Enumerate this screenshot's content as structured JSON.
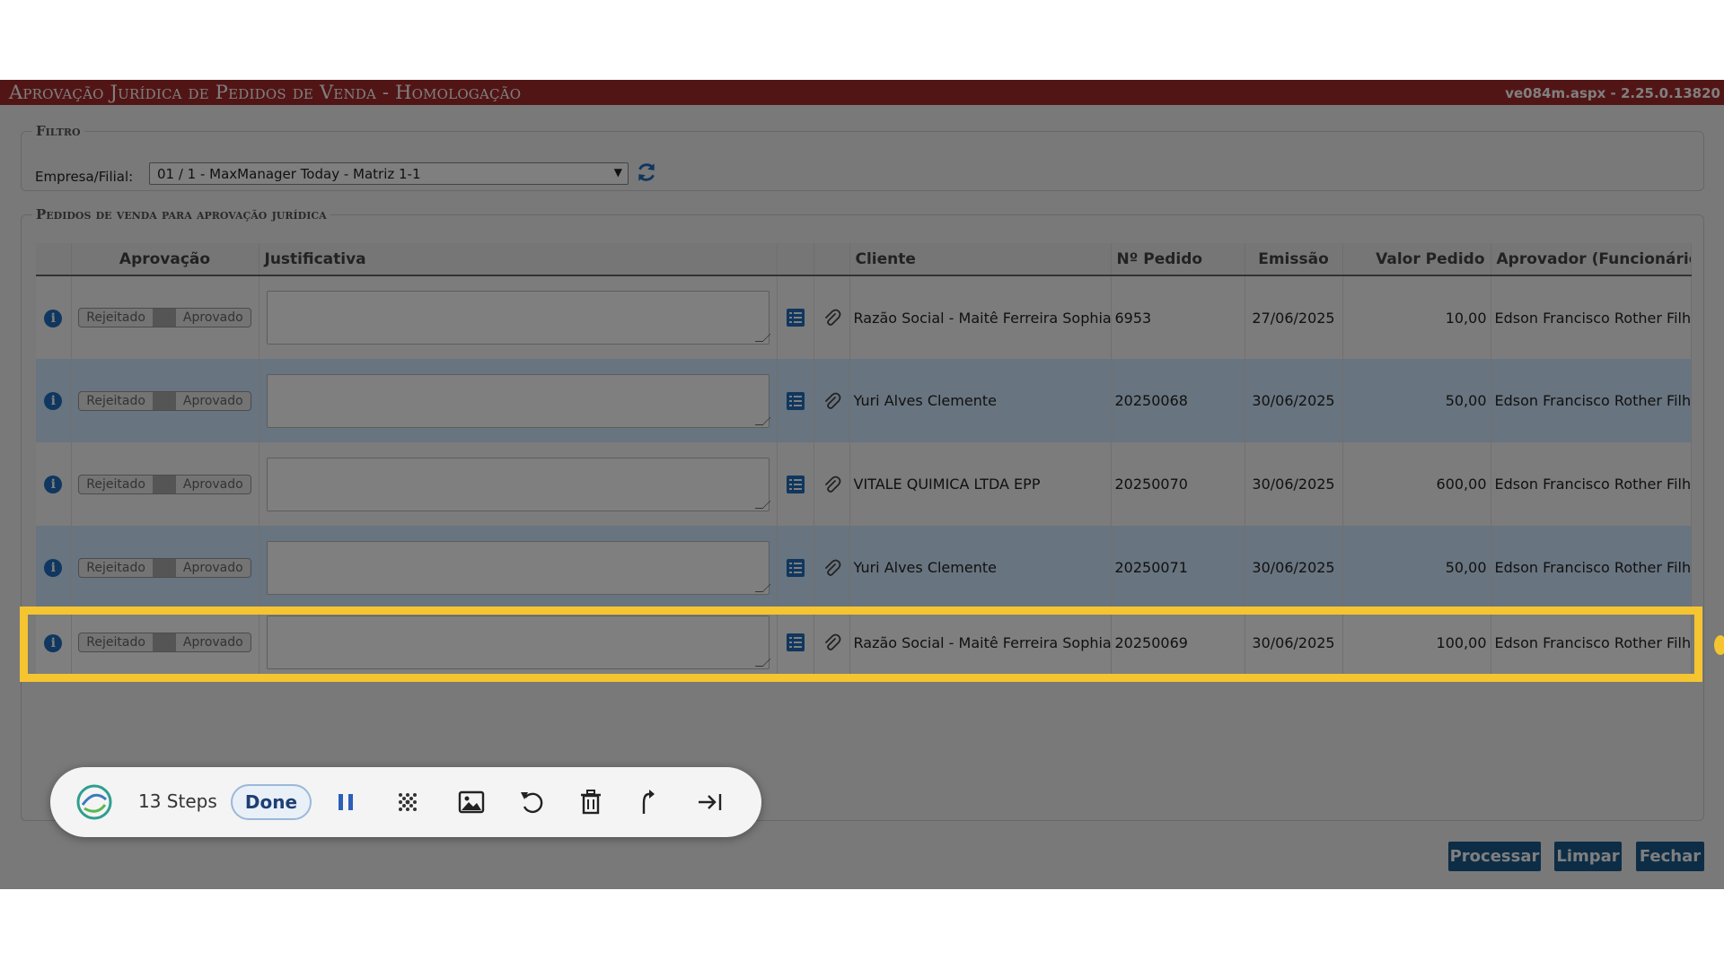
{
  "app": {
    "title": "Aprovação Jurídica de Pedidos de Venda  - Homologação",
    "version": "ve084m.aspx - 2.25.0.13820"
  },
  "filtro": {
    "legend": "Filtro",
    "empresa_label": "Empresa/Filial:",
    "empresa_value": "01 / 1 - MaxManager Today - Matriz 1-1"
  },
  "pedidos": {
    "legend": "Pedidos de venda para aprovação jurídica",
    "columns": {
      "aprovacao": "Aprovação",
      "justificativa": "Justificativa",
      "cliente": "Cliente",
      "pedido": "Nº Pedido",
      "emissao": "Emissão",
      "valor": "Valor Pedido",
      "aprovador": "Aprovador (Funcionário)"
    },
    "toggle": {
      "left": "Rejeitado",
      "right": "Aprovado"
    },
    "rows": [
      {
        "cliente": "Razão Social - Maitê Ferreira Sophia",
        "pedido": "6953",
        "emissao": "27/06/2025",
        "valor": "10,00",
        "aprovador": "Edson Francisco Rother Filho"
      },
      {
        "cliente": "Yuri Alves Clemente",
        "pedido": "20250068",
        "emissao": "30/06/2025",
        "valor": "50,00",
        "aprovador": "Edson Francisco Rother Filho"
      },
      {
        "cliente": "VITALE QUIMICA LTDA EPP",
        "pedido": "20250070",
        "emissao": "30/06/2025",
        "valor": "600,00",
        "aprovador": "Edson Francisco Rother Filho"
      },
      {
        "cliente": "Yuri Alves Clemente",
        "pedido": "20250071",
        "emissao": "30/06/2025",
        "valor": "50,00",
        "aprovador": "Edson Francisco Rother Filho"
      },
      {
        "cliente": "Razão Social - Maitê Ferreira Sophia",
        "pedido": "20250069",
        "emissao": "30/06/2025",
        "valor": "100,00",
        "aprovador": "Edson Francisco Rother Filho"
      }
    ]
  },
  "buttons": {
    "processar": "Processar",
    "limpar": "Limpar",
    "fechar": "Fechar"
  },
  "guide": {
    "steps": "13 Steps",
    "done": "Done"
  },
  "colors": {
    "titlebar": "#a52a2a",
    "highlight": "#f5c431",
    "button": "#1b5a8c",
    "row_alt": "#d0e8ff"
  },
  "icons": [
    "info-icon",
    "list-icon",
    "paperclip-icon",
    "refresh-icon",
    "pause-icon",
    "blur-icon",
    "image-icon",
    "undo-icon",
    "trash-icon",
    "share-icon",
    "skip-to-end-icon"
  ]
}
